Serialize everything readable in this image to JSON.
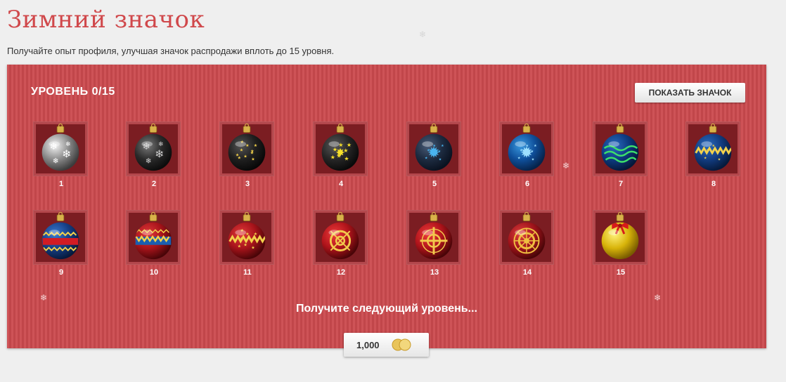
{
  "page": {
    "title": "Зимний значок",
    "subtitle": "Получайте опыт профиля, улучшая значок распродажи вплоть до 15 уровня."
  },
  "badge_panel": {
    "level_label": "УРОВЕНЬ 0/15",
    "show_badge_button": "ПОКАЗАТЬ ЗНАЧОК",
    "next_level_text": "Получите следующий уровень...",
    "price": "1,000",
    "currency_icon": "gems-icon",
    "colors": {
      "panel": "#cb4a4e",
      "title": "#d0484b"
    }
  },
  "badges": [
    {
      "level": "1",
      "ornament": "silver-snowflake-ornament-icon"
    },
    {
      "level": "2",
      "ornament": "black-snowflake-ornament-icon"
    },
    {
      "level": "3",
      "ornament": "black-star-ornament-icon"
    },
    {
      "level": "4",
      "ornament": "black-yellow-star-ornament-icon"
    },
    {
      "level": "5",
      "ornament": "dark-blue-star-ornament-icon"
    },
    {
      "level": "6",
      "ornament": "blue-star-ornament-icon"
    },
    {
      "level": "7",
      "ornament": "blue-green-ring-ornament-icon"
    },
    {
      "level": "8",
      "ornament": "blue-zigzag-ornament-icon"
    },
    {
      "level": "9",
      "ornament": "blue-red-band-ornament-icon"
    },
    {
      "level": "10",
      "ornament": "red-blue-band-ornament-icon"
    },
    {
      "level": "11",
      "ornament": "red-star-band-ornament-icon"
    },
    {
      "level": "12",
      "ornament": "red-gold-knot-ornament-icon"
    },
    {
      "level": "13",
      "ornament": "red-gold-cross-ornament-icon"
    },
    {
      "level": "14",
      "ornament": "red-gold-filigree-ornament-icon"
    },
    {
      "level": "15",
      "ornament": "gold-bow-ornament-icon"
    }
  ]
}
